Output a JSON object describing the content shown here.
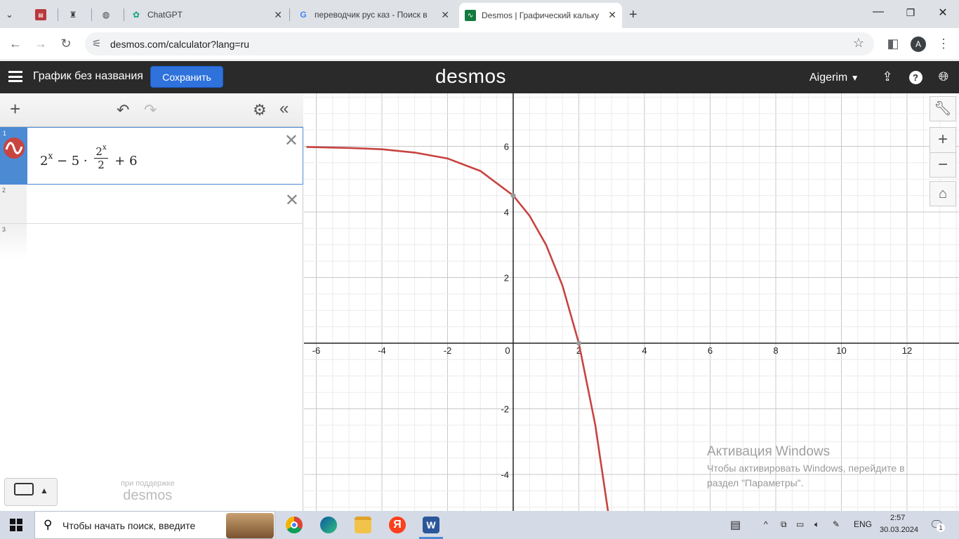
{
  "browser": {
    "tabs": [
      {
        "label": "",
        "icon": "ntc-favicon-icon"
      },
      {
        "label": "",
        "icon": "chess-favicon-icon"
      },
      {
        "label": "",
        "icon": "globe-favicon-icon"
      },
      {
        "label": "ChatGPT",
        "icon": "chatgpt-favicon-icon"
      },
      {
        "label": "переводчик рус каз - Поиск в",
        "icon": "google-favicon-icon"
      },
      {
        "label": "Desmos | Графический кальку",
        "icon": "desmos-favicon-icon"
      }
    ],
    "new_tab": "+",
    "address": "desmos.com/calculator?lang=ru",
    "profile_initial": "A"
  },
  "desmos": {
    "graph_title": "График без названия",
    "save_label": "Сохранить",
    "logo": "desmos",
    "user": "Aigerim",
    "expressions": [
      {
        "index": "1",
        "latex": "2^x - 5 · 2^x/2 + 6",
        "color": "#c74440"
      },
      {
        "index": "2",
        "latex": ""
      },
      {
        "index": "3",
        "latex": ""
      }
    ],
    "powered_by": "при поддержке",
    "powered_logo": "desmos"
  },
  "chart_data": {
    "type": "line",
    "function": "y = 2^x - 5*2^x/2 + 6",
    "series": [
      {
        "x": [
          -6.3,
          -5,
          -4,
          -3,
          -2,
          -1,
          0,
          0.5,
          1,
          1.5,
          2,
          2.5,
          2.9
        ],
        "y": [
          5.98,
          5.95,
          5.91,
          5.81,
          5.63,
          5.25,
          4.5,
          3.88,
          3.0,
          1.76,
          0.0,
          -2.49,
          -5.2
        ]
      }
    ],
    "color": "#c74440",
    "xlim": [
      -6.3,
      13.6
    ],
    "ylim": [
      -5.2,
      7.5
    ],
    "x_ticks": [
      "-6",
      "-4",
      "-2",
      "0",
      "2",
      "4",
      "6",
      "8",
      "10",
      "12"
    ],
    "y_ticks": [
      "6",
      "4",
      "2",
      "-2",
      "-4"
    ],
    "grid": true
  },
  "watermark": {
    "title": "Активация Windows",
    "body": "Чтобы активировать Windows, перейдите в раздел \"Параметры\"."
  },
  "taskbar": {
    "search_placeholder": "Чтобы начать поиск, введите",
    "lang": "ENG",
    "time": "2:57",
    "date": "30.03.2024",
    "notifications": "1"
  }
}
